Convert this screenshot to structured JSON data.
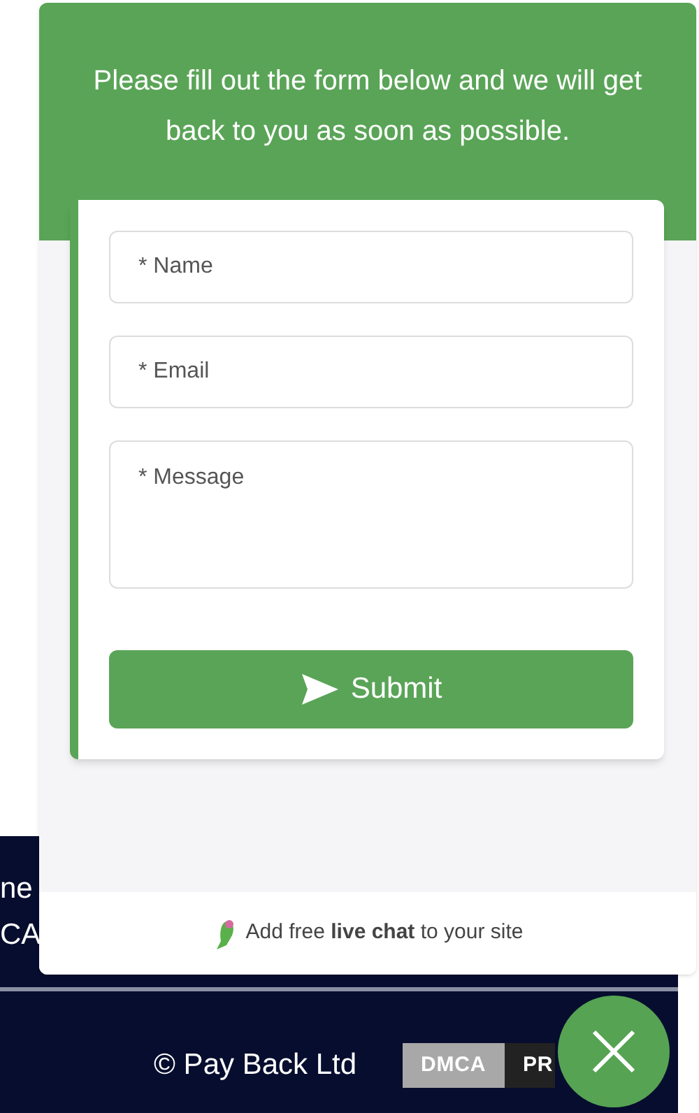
{
  "page": {
    "side_texts": [
      "ne",
      "CA"
    ],
    "copyright": "© Pay Back Ltd",
    "badges": [
      {
        "label": "DMCA",
        "kind": "light"
      },
      {
        "label": "PR",
        "kind": "dark"
      }
    ]
  },
  "widget": {
    "intro": "Please fill out the form below and we will get back to you as soon as possible.",
    "fields": [
      {
        "placeholder": "* Name",
        "kind": "line"
      },
      {
        "placeholder": "* Email",
        "kind": "line"
      },
      {
        "placeholder": "* Message",
        "kind": "area"
      }
    ],
    "submit": "Submit",
    "promo": "Add free **live chat** to your site"
  }
}
